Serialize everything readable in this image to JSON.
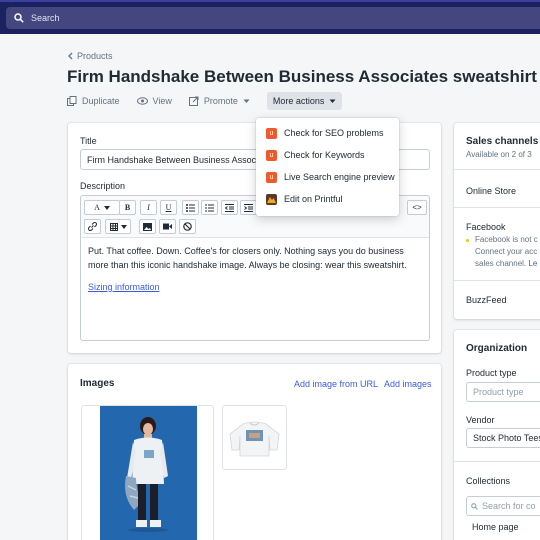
{
  "search": {
    "placeholder": "Search"
  },
  "breadcrumb": {
    "label": "Products"
  },
  "page": {
    "title": "Firm Handshake Between Business Associates sweatshirt"
  },
  "actions": {
    "duplicate": "Duplicate",
    "view": "View",
    "promote": "Promote",
    "more": "More actions"
  },
  "dropdown": {
    "items": [
      {
        "label": "Check for SEO problems",
        "icon": "seo-app-icon"
      },
      {
        "label": "Check for Keywords",
        "icon": "seo-app-icon"
      },
      {
        "label": "Live Search engine preview",
        "icon": "seo-app-icon"
      },
      {
        "label": "Edit on Printful",
        "icon": "printful-icon"
      }
    ]
  },
  "product": {
    "title_label": "Title",
    "title_value": "Firm Handshake Between Business Associates sweatshirt",
    "description_label": "Description",
    "description_text": "Put. That coffee. Down. Coffee's for closers only. Nothing says you do business more than this iconic handshake image. Always be closing: wear this sweatshirt.",
    "sizing_link": "Sizing information"
  },
  "toolbar": {
    "font_label": "A",
    "bold": "B",
    "italic": "I",
    "underline": "U",
    "code": "<>"
  },
  "images": {
    "title": "Images",
    "add_from_url": "Add image from URL",
    "add_images": "Add images"
  },
  "sales_channels": {
    "title": "Sales channels",
    "subtitle": "Available on 2 of 3",
    "online_store": "Online Store",
    "facebook": "Facebook",
    "facebook_warning_1": "Facebook is not c",
    "facebook_warning_2": "Connect your acc",
    "facebook_warning_3a": "sales channel.",
    "facebook_warning_3b": "Le",
    "buzzfeed": "BuzzFeed"
  },
  "organization": {
    "title": "Organization",
    "product_type_label": "Product type",
    "product_type_placeholder": "Product type",
    "vendor_label": "Vendor",
    "vendor_value": "Stock Photo Tees",
    "collections_label": "Collections",
    "collections_placeholder": "Search for co",
    "home_page": "Home page"
  },
  "colors": {
    "topbar": "#1c2260",
    "link": "#3d5cdb",
    "app_icon": "#f05a28"
  }
}
